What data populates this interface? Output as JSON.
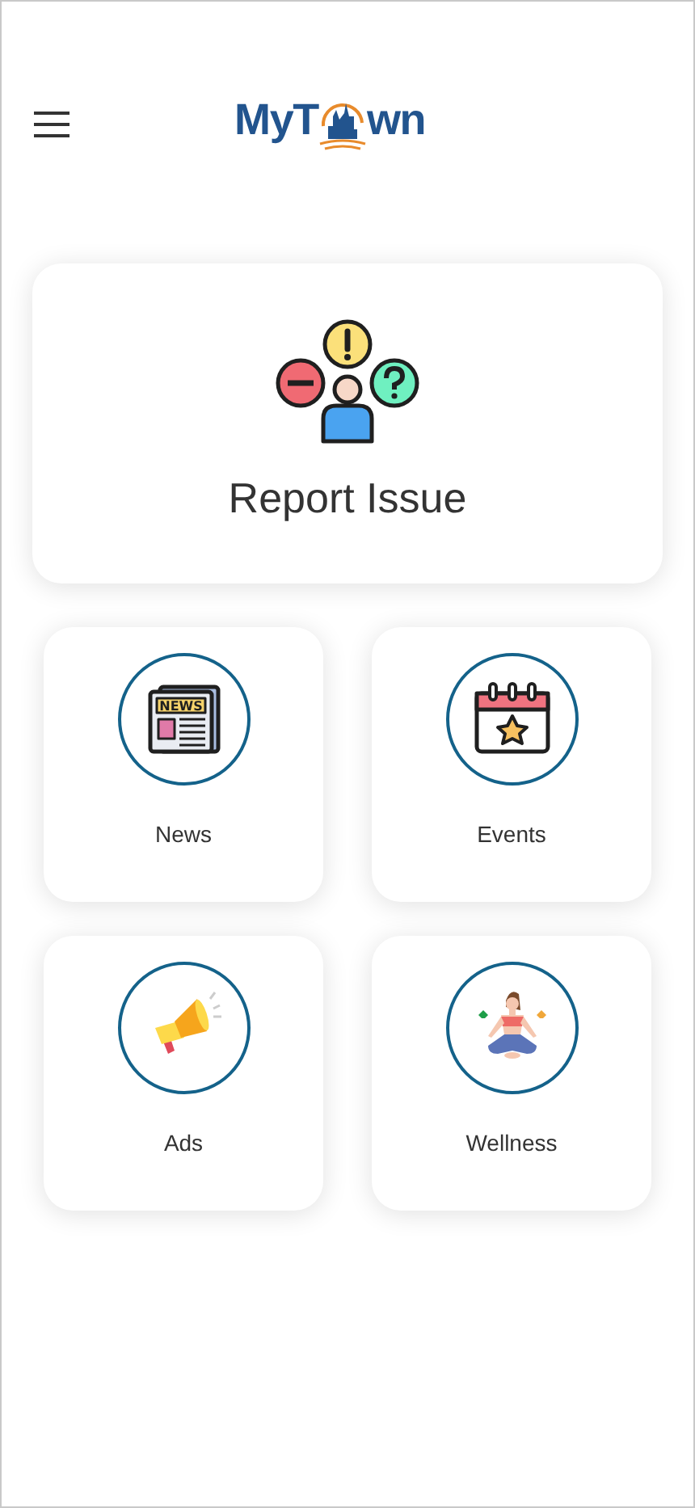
{
  "header": {
    "logo_start": "MyT",
    "logo_end": "wn"
  },
  "report": {
    "label": "Report Issue"
  },
  "tiles": [
    {
      "kind": "news",
      "label": "News",
      "headline": "NEWS"
    },
    {
      "kind": "events",
      "label": "Events"
    },
    {
      "kind": "ads",
      "label": "Ads"
    },
    {
      "kind": "wellness",
      "label": "Wellness"
    }
  ]
}
